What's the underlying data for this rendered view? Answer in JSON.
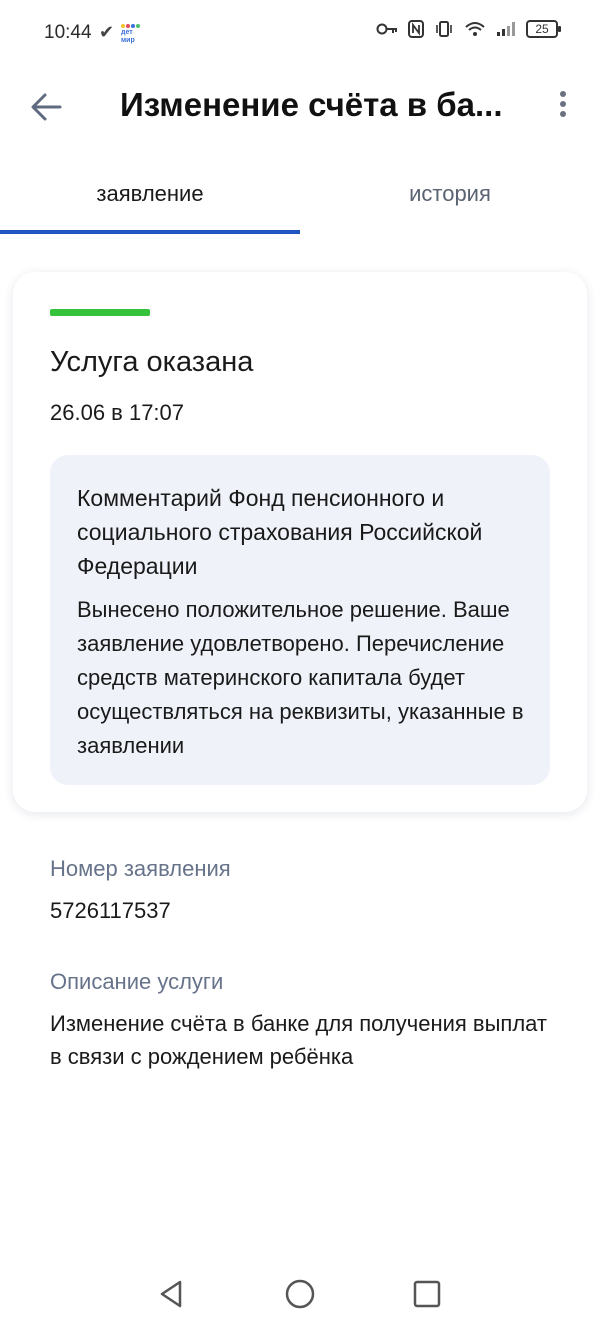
{
  "status_bar": {
    "time": "10:44",
    "app_badge": "дет мир",
    "battery": "25"
  },
  "header": {
    "title": "Изменение счёта в ба..."
  },
  "tabs": [
    {
      "label": "заявление",
      "active": true
    },
    {
      "label": "история",
      "active": false
    }
  ],
  "status_card": {
    "status": "Услуга оказана",
    "status_color": "#36c13a",
    "date": "26.06 в 17:07",
    "comment_title": "Комментарий Фонд пенсионного и социального страхования Российской Федерации",
    "comment_text": "Вынесено положительное решение. Ваше заявление удовлетворено. Перечисление средств материнского капитала будет осуществляться на реквизиты, указанные в заявлении"
  },
  "details": {
    "number_label": "Номер заявления",
    "number_value": "5726117537",
    "description_label": "Описание услуги",
    "description_value": "Изменение счёта в банке для получения выплат в связи с рождением ребёнка"
  },
  "colors": {
    "accent": "#1f55c2",
    "label_gray": "#66738a",
    "comment_bg": "#eff3f9"
  }
}
